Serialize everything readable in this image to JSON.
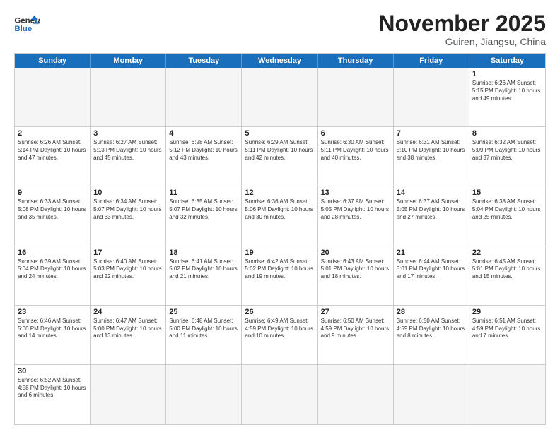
{
  "header": {
    "logo_general": "General",
    "logo_blue": "Blue",
    "month": "November 2025",
    "location": "Guiren, Jiangsu, China"
  },
  "days_of_week": [
    "Sunday",
    "Monday",
    "Tuesday",
    "Wednesday",
    "Thursday",
    "Friday",
    "Saturday"
  ],
  "weeks": [
    [
      {
        "day": "",
        "info": ""
      },
      {
        "day": "",
        "info": ""
      },
      {
        "day": "",
        "info": ""
      },
      {
        "day": "",
        "info": ""
      },
      {
        "day": "",
        "info": ""
      },
      {
        "day": "",
        "info": ""
      },
      {
        "day": "1",
        "info": "Sunrise: 6:26 AM\nSunset: 5:15 PM\nDaylight: 10 hours and 49 minutes."
      }
    ],
    [
      {
        "day": "2",
        "info": "Sunrise: 6:26 AM\nSunset: 5:14 PM\nDaylight: 10 hours and 47 minutes."
      },
      {
        "day": "3",
        "info": "Sunrise: 6:27 AM\nSunset: 5:13 PM\nDaylight: 10 hours and 45 minutes."
      },
      {
        "day": "4",
        "info": "Sunrise: 6:28 AM\nSunset: 5:12 PM\nDaylight: 10 hours and 43 minutes."
      },
      {
        "day": "5",
        "info": "Sunrise: 6:29 AM\nSunset: 5:11 PM\nDaylight: 10 hours and 42 minutes."
      },
      {
        "day": "6",
        "info": "Sunrise: 6:30 AM\nSunset: 5:11 PM\nDaylight: 10 hours and 40 minutes."
      },
      {
        "day": "7",
        "info": "Sunrise: 6:31 AM\nSunset: 5:10 PM\nDaylight: 10 hours and 38 minutes."
      },
      {
        "day": "8",
        "info": "Sunrise: 6:32 AM\nSunset: 5:09 PM\nDaylight: 10 hours and 37 minutes."
      }
    ],
    [
      {
        "day": "9",
        "info": "Sunrise: 6:33 AM\nSunset: 5:08 PM\nDaylight: 10 hours and 35 minutes."
      },
      {
        "day": "10",
        "info": "Sunrise: 6:34 AM\nSunset: 5:07 PM\nDaylight: 10 hours and 33 minutes."
      },
      {
        "day": "11",
        "info": "Sunrise: 6:35 AM\nSunset: 5:07 PM\nDaylight: 10 hours and 32 minutes."
      },
      {
        "day": "12",
        "info": "Sunrise: 6:36 AM\nSunset: 5:06 PM\nDaylight: 10 hours and 30 minutes."
      },
      {
        "day": "13",
        "info": "Sunrise: 6:37 AM\nSunset: 5:05 PM\nDaylight: 10 hours and 28 minutes."
      },
      {
        "day": "14",
        "info": "Sunrise: 6:37 AM\nSunset: 5:05 PM\nDaylight: 10 hours and 27 minutes."
      },
      {
        "day": "15",
        "info": "Sunrise: 6:38 AM\nSunset: 5:04 PM\nDaylight: 10 hours and 25 minutes."
      }
    ],
    [
      {
        "day": "16",
        "info": "Sunrise: 6:39 AM\nSunset: 5:04 PM\nDaylight: 10 hours and 24 minutes."
      },
      {
        "day": "17",
        "info": "Sunrise: 6:40 AM\nSunset: 5:03 PM\nDaylight: 10 hours and 22 minutes."
      },
      {
        "day": "18",
        "info": "Sunrise: 6:41 AM\nSunset: 5:02 PM\nDaylight: 10 hours and 21 minutes."
      },
      {
        "day": "19",
        "info": "Sunrise: 6:42 AM\nSunset: 5:02 PM\nDaylight: 10 hours and 19 minutes."
      },
      {
        "day": "20",
        "info": "Sunrise: 6:43 AM\nSunset: 5:01 PM\nDaylight: 10 hours and 18 minutes."
      },
      {
        "day": "21",
        "info": "Sunrise: 6:44 AM\nSunset: 5:01 PM\nDaylight: 10 hours and 17 minutes."
      },
      {
        "day": "22",
        "info": "Sunrise: 6:45 AM\nSunset: 5:01 PM\nDaylight: 10 hours and 15 minutes."
      }
    ],
    [
      {
        "day": "23",
        "info": "Sunrise: 6:46 AM\nSunset: 5:00 PM\nDaylight: 10 hours and 14 minutes."
      },
      {
        "day": "24",
        "info": "Sunrise: 6:47 AM\nSunset: 5:00 PM\nDaylight: 10 hours and 13 minutes."
      },
      {
        "day": "25",
        "info": "Sunrise: 6:48 AM\nSunset: 5:00 PM\nDaylight: 10 hours and 11 minutes."
      },
      {
        "day": "26",
        "info": "Sunrise: 6:49 AM\nSunset: 4:59 PM\nDaylight: 10 hours and 10 minutes."
      },
      {
        "day": "27",
        "info": "Sunrise: 6:50 AM\nSunset: 4:59 PM\nDaylight: 10 hours and 9 minutes."
      },
      {
        "day": "28",
        "info": "Sunrise: 6:50 AM\nSunset: 4:59 PM\nDaylight: 10 hours and 8 minutes."
      },
      {
        "day": "29",
        "info": "Sunrise: 6:51 AM\nSunset: 4:59 PM\nDaylight: 10 hours and 7 minutes."
      }
    ],
    [
      {
        "day": "30",
        "info": "Sunrise: 6:52 AM\nSunset: 4:58 PM\nDaylight: 10 hours and 6 minutes."
      },
      {
        "day": "",
        "info": ""
      },
      {
        "day": "",
        "info": ""
      },
      {
        "day": "",
        "info": ""
      },
      {
        "day": "",
        "info": ""
      },
      {
        "day": "",
        "info": ""
      },
      {
        "day": "",
        "info": ""
      }
    ]
  ]
}
